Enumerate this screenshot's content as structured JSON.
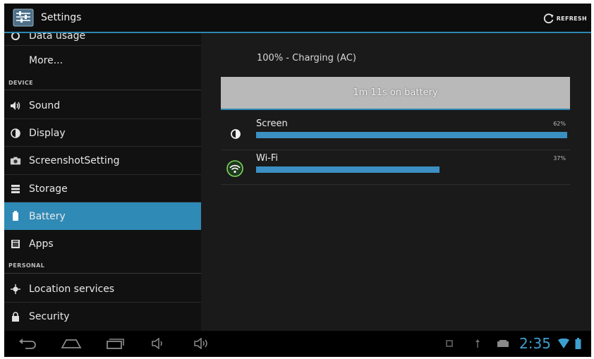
{
  "action_bar": {
    "title": "Settings",
    "refresh_label": "REFRESH",
    "accent_color": "#2c87b2"
  },
  "sidebar": {
    "partial_item": "Data usage",
    "more_label": "More...",
    "device_section": "DEVICE",
    "personal_section": "PERSONAL",
    "items": [
      {
        "label": "Sound",
        "icon": "speaker-icon"
      },
      {
        "label": "Display",
        "icon": "brightness-icon"
      },
      {
        "label": "ScreenshotSetting",
        "icon": "camera-icon"
      },
      {
        "label": "Storage",
        "icon": "storage-icon"
      },
      {
        "label": "Battery",
        "icon": "battery-icon",
        "selected": true
      },
      {
        "label": "Apps",
        "icon": "apps-icon"
      }
    ],
    "personal_items": [
      {
        "label": "Location services",
        "icon": "location-icon"
      },
      {
        "label": "Security",
        "icon": "lock-icon"
      }
    ],
    "selected_color": "#2f8ab6"
  },
  "battery": {
    "status": "100% - Charging (AC)",
    "graph_label": "1m 11s on battery",
    "usage": [
      {
        "name": "Screen",
        "percent_label": "62%",
        "fraction": 1.0,
        "icon": "brightness-icon"
      },
      {
        "name": "Wi-Fi",
        "percent_label": "37%",
        "fraction": 0.59,
        "icon": "wifi-icon"
      }
    ],
    "bar_color": "#3b8fc2"
  },
  "nav_bar": {
    "time": "2:35",
    "clock_color": "#3d9fd0"
  }
}
